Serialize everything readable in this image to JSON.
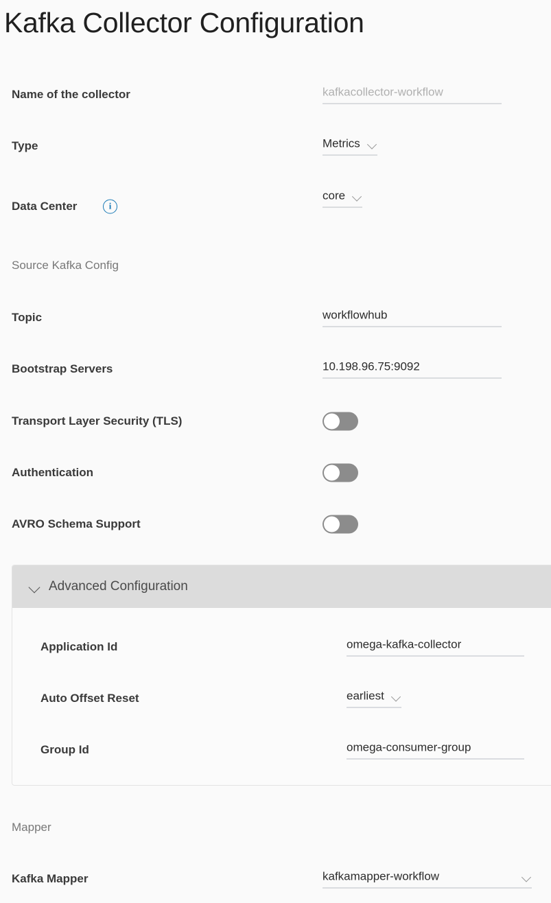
{
  "page": {
    "title": "Kafka Collector Configuration"
  },
  "fields": {
    "collector_name": {
      "label": "Name of the collector",
      "placeholder": "kafkacollector-workflow",
      "value": ""
    },
    "type": {
      "label": "Type",
      "value": "Metrics"
    },
    "data_center": {
      "label": "Data Center",
      "value": "core",
      "info_icon": "info-icon",
      "info_glyph": "i"
    }
  },
  "source_kafka_config": {
    "heading": "Source Kafka Config",
    "topic": {
      "label": "Topic",
      "value": "workflowhub"
    },
    "bootstrap_servers": {
      "label": "Bootstrap Servers",
      "value": "10.198.96.75:9092"
    },
    "tls": {
      "label": "Transport Layer Security (TLS)",
      "state": "off"
    },
    "authentication": {
      "label": "Authentication",
      "state": "off"
    },
    "avro": {
      "label": "AVRO Schema Support",
      "state": "off"
    }
  },
  "advanced": {
    "title": "Advanced Configuration",
    "expanded": true,
    "application_id": {
      "label": "Application Id",
      "value": "omega-kafka-collector"
    },
    "auto_offset_reset": {
      "label": "Auto Offset Reset",
      "value": "earliest"
    },
    "group_id": {
      "label": "Group Id",
      "value": "omega-consumer-group"
    }
  },
  "mapper": {
    "heading": "Mapper",
    "kafka_mapper": {
      "label": "Kafka Mapper",
      "value": "kafkamapper-workflow"
    }
  },
  "colors": {
    "background": "#fafafa",
    "label_text": "#3a3a3a",
    "section_text": "#787878",
    "underline": "#b9bdc4",
    "info_accent": "#1879b5",
    "toggle_off_track": "#8c8c8c",
    "advanced_header": "#dcdcdc"
  }
}
